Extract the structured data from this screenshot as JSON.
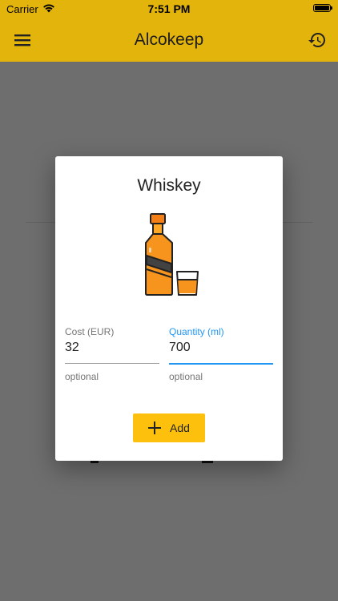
{
  "status_bar": {
    "carrier": "Carrier",
    "time": "7:51 PM",
    "icons": [
      "wifi-icon",
      "battery-icon"
    ]
  },
  "app_bar": {
    "title": "Alcokeep",
    "icons": [
      "menu-icon",
      "history-icon"
    ],
    "color": "#e3b40b"
  },
  "dialog": {
    "title": "Whiskey",
    "illustration": "whiskey-bottle-and-glass-icon",
    "fields": [
      {
        "label": "Cost (EUR)",
        "value": "32",
        "helper": "optional",
        "focused": false
      },
      {
        "label": "Quantity (ml)",
        "value": "700",
        "helper": "optional",
        "focused": true
      }
    ],
    "add_button": {
      "label": "Add",
      "icon": "plus-icon",
      "color": "#fdc10d"
    }
  },
  "colors": {
    "accent": "#e3b40b",
    "focus": "#2196f3",
    "button": "#fdc10d"
  }
}
